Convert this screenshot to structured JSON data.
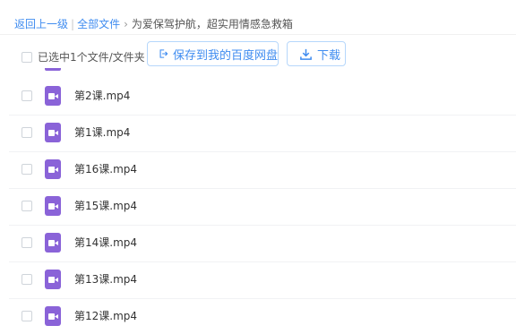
{
  "breadcrumb": {
    "back": "返回上一级",
    "separator": "|",
    "all_files": "全部文件",
    "arrow": "›",
    "current": "为爱保驾护航，超实用情感急救箱"
  },
  "toolbar": {
    "selection_text": "已选中1个文件/文件夹",
    "save_label": "保存到我的百度网盘",
    "download_label": "下载"
  },
  "files": [
    {
      "name": "第2课.mp4",
      "icon": "video-file-icon"
    },
    {
      "name": "第1课.mp4",
      "icon": "video-file-icon"
    },
    {
      "name": "第16课.mp4",
      "icon": "video-file-icon"
    },
    {
      "name": "第15课.mp4",
      "icon": "video-file-icon"
    },
    {
      "name": "第14课.mp4",
      "icon": "video-file-icon"
    },
    {
      "name": "第13课.mp4",
      "icon": "video-file-icon"
    },
    {
      "name": "第12课.mp4",
      "icon": "video-file-icon"
    }
  ],
  "colors": {
    "accent": "#3f8cf0",
    "file_icon": "#8a63d8"
  }
}
